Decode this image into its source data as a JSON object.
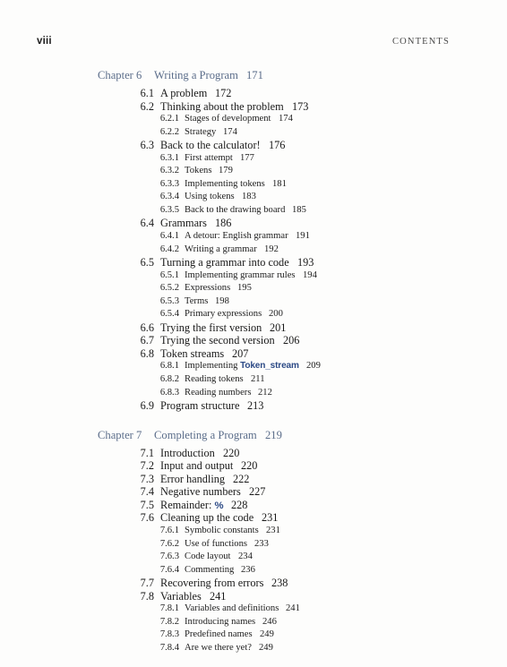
{
  "header": {
    "folio": "viii",
    "title": "CONTENTS"
  },
  "colors": {
    "chapter_blue": "#5b6d8a",
    "code_blue": "#2c4a86",
    "body_text": "#191919",
    "page_background": "#fdfdfc"
  },
  "entries": [
    {
      "level": "chapter",
      "number": "Chapter 6",
      "title": "Writing a Program",
      "page": "171"
    },
    {
      "level": 2,
      "number": "6.1",
      "title": "A problem",
      "page": "172"
    },
    {
      "level": 2,
      "number": "6.2",
      "title": "Thinking about the problem",
      "page": "173"
    },
    {
      "level": 3,
      "number": "6.2.1",
      "title": "Stages of development",
      "page": "174"
    },
    {
      "level": 3,
      "number": "6.2.2",
      "title": "Strategy",
      "page": "174"
    },
    {
      "level": 2,
      "number": "6.3",
      "title": "Back to the calculator!",
      "page": "176"
    },
    {
      "level": 3,
      "number": "6.3.1",
      "title": "First attempt",
      "page": "177"
    },
    {
      "level": 3,
      "number": "6.3.2",
      "title": "Tokens",
      "page": "179"
    },
    {
      "level": 3,
      "number": "6.3.3",
      "title": "Implementing tokens",
      "page": "181"
    },
    {
      "level": 3,
      "number": "6.3.4",
      "title": "Using tokens",
      "page": "183"
    },
    {
      "level": 3,
      "number": "6.3.5",
      "title": "Back to the drawing board",
      "page": "185"
    },
    {
      "level": 2,
      "number": "6.4",
      "title": "Grammars",
      "page": "186"
    },
    {
      "level": 3,
      "number": "6.4.1",
      "title": "A detour: English grammar",
      "page": "191"
    },
    {
      "level": 3,
      "number": "6.4.2",
      "title": "Writing a grammar",
      "page": "192"
    },
    {
      "level": 2,
      "number": "6.5",
      "title": "Turning a grammar into code",
      "page": "193"
    },
    {
      "level": 3,
      "number": "6.5.1",
      "title": "Implementing grammar rules",
      "page": "194"
    },
    {
      "level": 3,
      "number": "6.5.2",
      "title": "Expressions",
      "page": "195"
    },
    {
      "level": 3,
      "number": "6.5.3",
      "title": "Terms",
      "page": "198"
    },
    {
      "level": 3,
      "number": "6.5.4",
      "title": "Primary expressions",
      "page": "200"
    },
    {
      "level": 2,
      "number": "6.6",
      "title": "Trying the first version",
      "page": "201"
    },
    {
      "level": 2,
      "number": "6.7",
      "title": "Trying the second version",
      "page": "206"
    },
    {
      "level": 2,
      "number": "6.8",
      "title": "Token streams",
      "page": "207"
    },
    {
      "level": 3,
      "number": "6.8.1",
      "title": "Implementing ",
      "code": "Token_stream",
      "title_after": "",
      "page": "209"
    },
    {
      "level": 3,
      "number": "6.8.2",
      "title": "Reading tokens",
      "page": "211"
    },
    {
      "level": 3,
      "number": "6.8.3",
      "title": "Reading numbers",
      "page": "212"
    },
    {
      "level": 2,
      "number": "6.9",
      "title": "Program structure",
      "page": "213"
    },
    {
      "level": "chapter",
      "number": "Chapter 7",
      "title": "Completing a Program",
      "page": "219"
    },
    {
      "level": 2,
      "number": "7.1",
      "title": "Introduction",
      "page": "220"
    },
    {
      "level": 2,
      "number": "7.2",
      "title": "Input and output",
      "page": "220"
    },
    {
      "level": 2,
      "number": "7.3",
      "title": "Error handling",
      "page": "222"
    },
    {
      "level": 2,
      "number": "7.4",
      "title": "Negative numbers",
      "page": "227"
    },
    {
      "level": 2,
      "number": "7.5",
      "title": "Remainder: ",
      "code": "%",
      "title_after": "",
      "page": "228"
    },
    {
      "level": 2,
      "number": "7.6",
      "title": "Cleaning up the code",
      "page": "231"
    },
    {
      "level": 3,
      "number": "7.6.1",
      "title": "Symbolic constants",
      "page": "231"
    },
    {
      "level": 3,
      "number": "7.6.2",
      "title": "Use of functions",
      "page": "233"
    },
    {
      "level": 3,
      "number": "7.6.3",
      "title": "Code layout",
      "page": "234"
    },
    {
      "level": 3,
      "number": "7.6.4",
      "title": "Commenting",
      "page": "236"
    },
    {
      "level": 2,
      "number": "7.7",
      "title": "Recovering from errors",
      "page": "238"
    },
    {
      "level": 2,
      "number": "7.8",
      "title": "Variables",
      "page": "241"
    },
    {
      "level": 3,
      "number": "7.8.1",
      "title": "Variables and definitions",
      "page": "241"
    },
    {
      "level": 3,
      "number": "7.8.2",
      "title": "Introducing names",
      "page": "246"
    },
    {
      "level": 3,
      "number": "7.8.3",
      "title": "Predefined names",
      "page": "249"
    },
    {
      "level": 3,
      "number": "7.8.4",
      "title": "Are we there yet?",
      "page": "249"
    }
  ]
}
